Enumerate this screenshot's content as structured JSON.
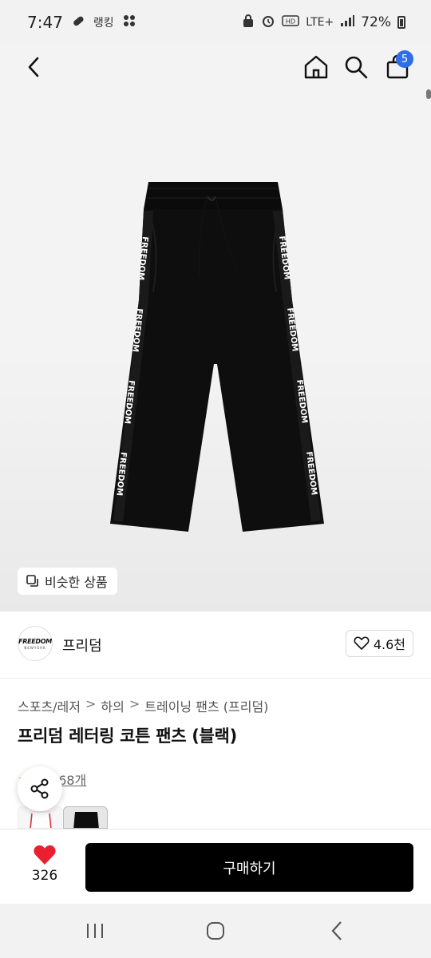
{
  "status_bar": {
    "time": "7:47",
    "app_pill": "랭킹",
    "network": "LTE+",
    "battery": "72%"
  },
  "header": {
    "cart_count": "5"
  },
  "similar_products_label": "비슷한 상품",
  "brand": {
    "logo_text": "FREEDOM",
    "logo_sub": "NEWYORK",
    "name": "프리덤",
    "likes": "4.6천"
  },
  "breadcrumb": [
    "스포츠/레저",
    "하의",
    "트레이닝 팬츠 (프리덤)"
  ],
  "breadcrumb_sep": ">",
  "product": {
    "title": "프리덤 레터링 코튼 팬츠 (블랙)",
    "review_label": "후기 68개",
    "tape_text": "FREEDOM"
  },
  "buy_bar": {
    "wish_count": "326",
    "buy_label": "구매하기"
  },
  "colors": {
    "accent": "#2f6ee8",
    "heart": "#e8202f",
    "star": "#f5b300"
  }
}
